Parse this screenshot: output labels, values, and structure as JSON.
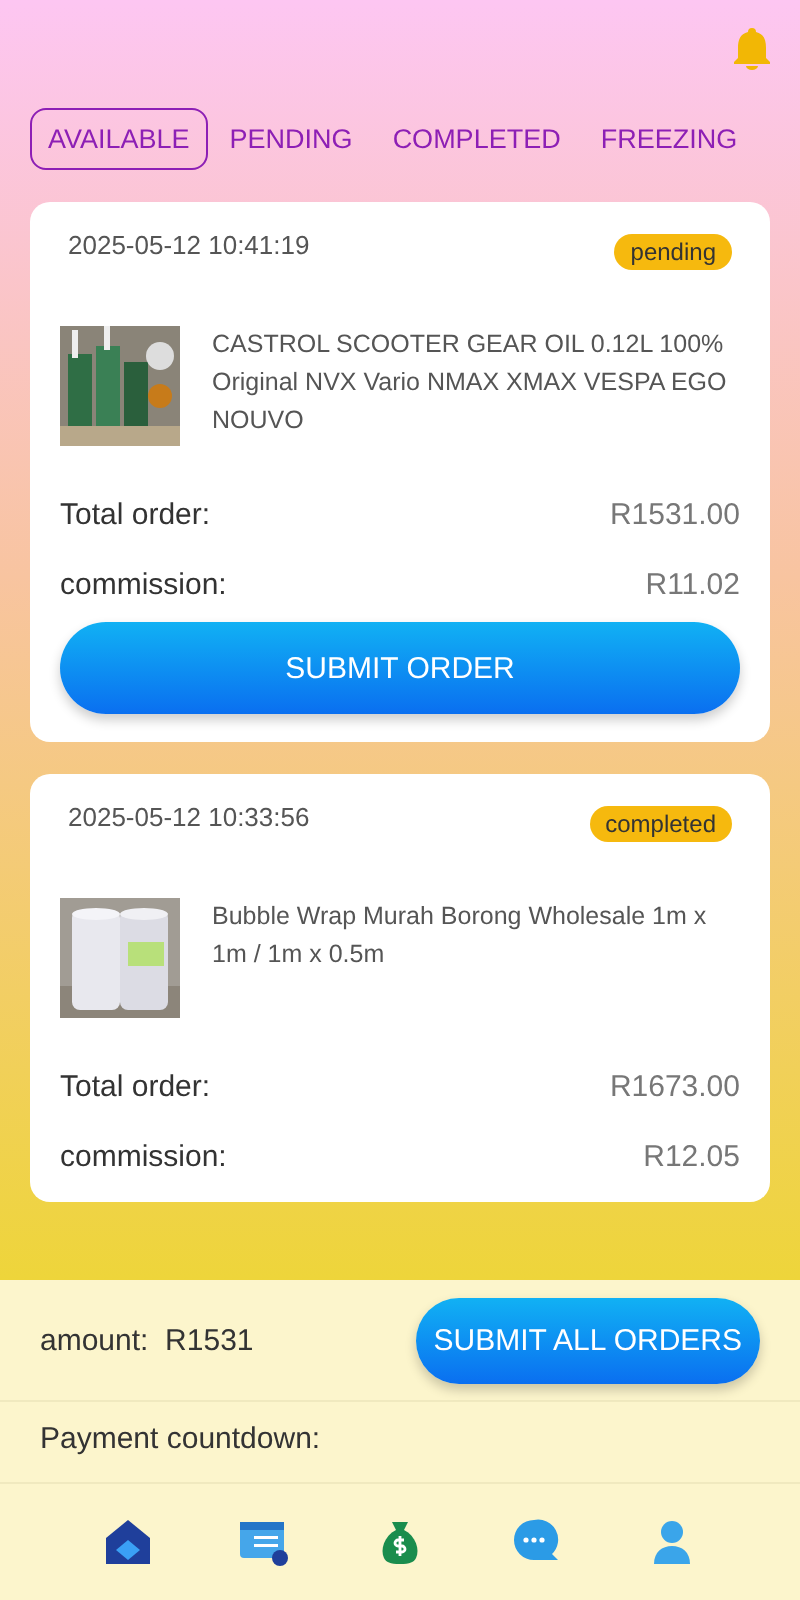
{
  "tabs": [
    {
      "label": "AVAILABLE",
      "selected": true
    },
    {
      "label": "PENDING",
      "selected": false
    },
    {
      "label": "COMPLETED",
      "selected": false
    },
    {
      "label": "FREEZING",
      "selected": false
    }
  ],
  "orders": [
    {
      "time": "2025-05-12 10:41:19",
      "status": "pending",
      "title": "CASTROL SCOOTER GEAR OIL 0.12L 100% Original NVX Vario NMAX XMAX VESPA EGO NOUVO",
      "total_label": "Total order:",
      "total": "R1531.00",
      "commission_label": "commission:",
      "commission": "R11.02",
      "button": "SUBMIT ORDER"
    },
    {
      "time": "2025-05-12 10:33:56",
      "status": "completed",
      "title": "Bubble Wrap Murah Borong Wholesale 1m x 1m / 1m x 0.5m",
      "total_label": "Total order:",
      "total": "R1673.00",
      "commission_label": "commission:",
      "commission": "R12.05"
    }
  ],
  "footer": {
    "amount_label": "amount:",
    "amount": "R1531",
    "submit_all": "SUBMIT ALL ORDERS",
    "countdown_label": "Payment countdown:"
  },
  "nav": [
    {
      "kind": "home"
    },
    {
      "kind": "orders"
    },
    {
      "kind": "money"
    },
    {
      "kind": "chat"
    },
    {
      "kind": "profile"
    }
  ]
}
